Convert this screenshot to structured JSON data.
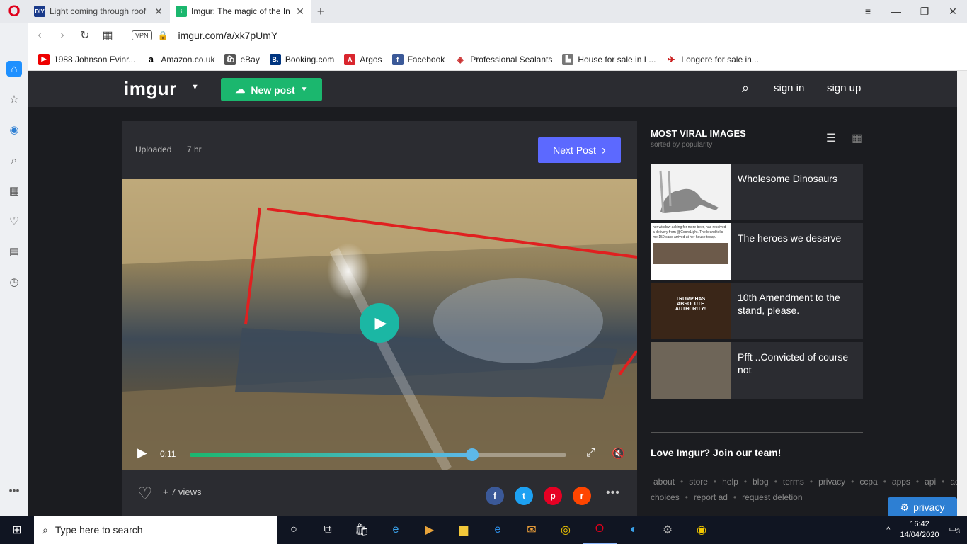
{
  "browser": {
    "tabs": [
      {
        "label": "Light coming through roof",
        "favicon": "DIY"
      },
      {
        "label": "Imgur: The magic of the Int",
        "favicon": "imgur-icon"
      }
    ],
    "url": "imgur.com/a/xk7pUmY",
    "vpn_label": "VPN"
  },
  "bookmarks": [
    {
      "label": "1988 Johnson Evinr...",
      "icon": "youtube-icon"
    },
    {
      "label": "Amazon.co.uk",
      "icon": "amazon-icon"
    },
    {
      "label": "eBay",
      "icon": "ebay-icon"
    },
    {
      "label": "Booking.com",
      "icon": "booking-icon"
    },
    {
      "label": "Argos",
      "icon": "argos-icon"
    },
    {
      "label": "Facebook",
      "icon": "facebook-icon"
    },
    {
      "label": "Professional Sealants",
      "icon": "sealants-icon"
    },
    {
      "label": "House for sale in L...",
      "icon": "house-icon"
    },
    {
      "label": "Longere for sale in...",
      "icon": "longere-icon"
    }
  ],
  "imgur": {
    "logo": "imgur",
    "new_post": "New post",
    "sign_in": "sign in",
    "sign_up": "sign up",
    "post": {
      "uploaded_label": "Uploaded",
      "uploaded_time": "7 hr",
      "next_post": "Next Post",
      "video_time": "0:11",
      "progress": 0.75,
      "views": "+ 7 views"
    },
    "viral": {
      "title": "MOST VIRAL IMAGES",
      "subtitle": "sorted by popularity",
      "items": [
        {
          "title": "Wholesome Dinosaurs"
        },
        {
          "title": "The heroes we deserve"
        },
        {
          "title": "10th Amendment to the stand, please."
        },
        {
          "title": "Pfft ..Convicted of course not"
        }
      ]
    },
    "join": "Love Imgur? Join our team!",
    "footer_links": [
      "about",
      "store",
      "help",
      "blog",
      "terms",
      "privacy",
      "ccpa",
      "apps",
      "api",
      "advertise",
      "ad choices",
      "report ad",
      "request deletion"
    ],
    "privacy_button": "privacy",
    "thumb_texts": {
      "heroes": "her window asking for more beer, has received a delivery from @CoorsLight. The brand tells me 150 cans arrived at her house today.",
      "amendment": "TRUMP HAS ABSOLUTE AUTHORITY!"
    }
  },
  "taskbar": {
    "search_placeholder": "Type here to search",
    "time": "16:42",
    "date": "14/04/2020",
    "notifications": "3"
  },
  "colors": {
    "imgur_green": "#1bb76e",
    "next_post_blue": "#5c69ff",
    "page_bg": "#1b1c20"
  }
}
